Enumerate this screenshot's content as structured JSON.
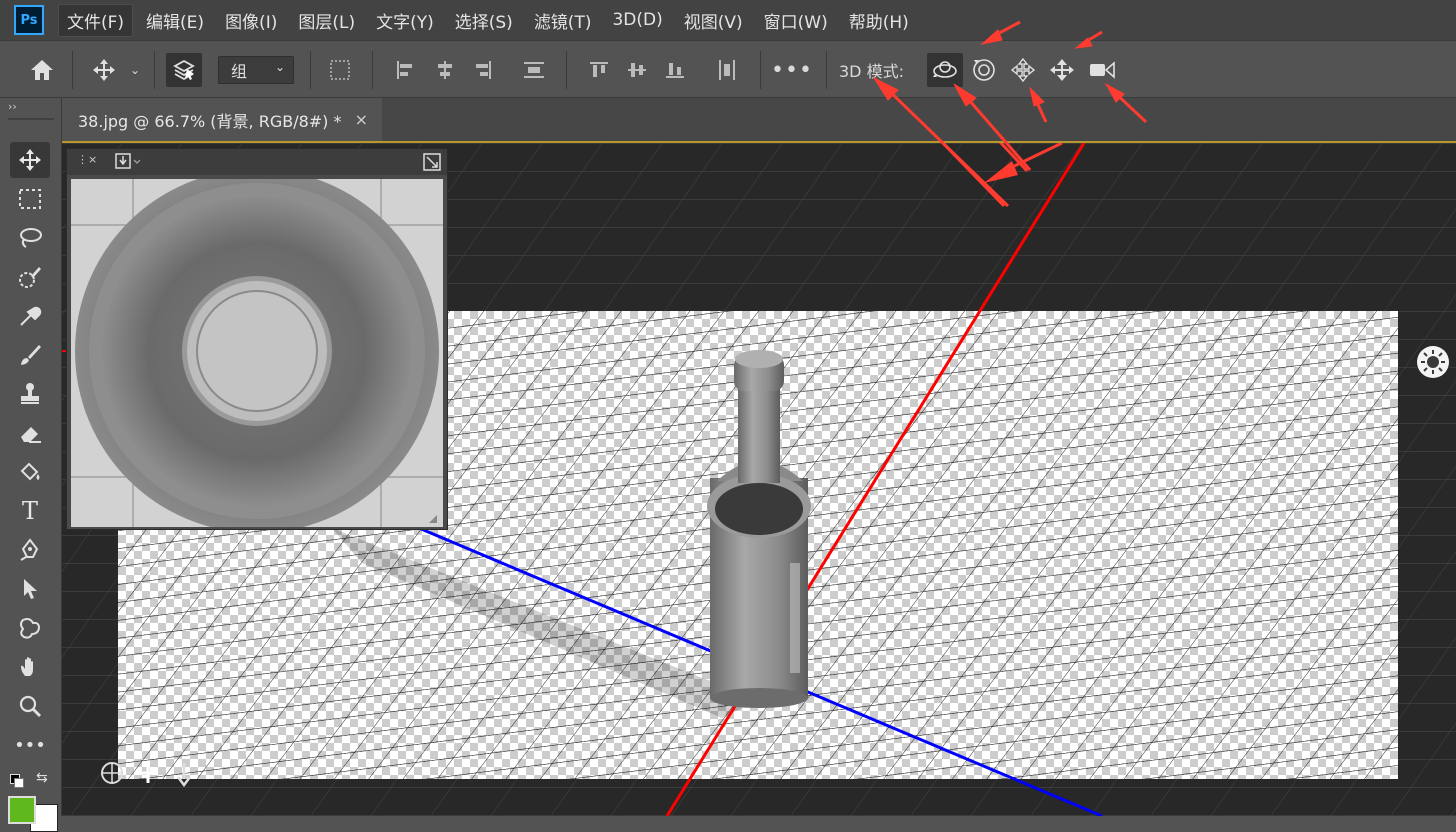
{
  "app": {
    "logo": "Ps"
  },
  "menu": [
    "文件(F)",
    "编辑(E)",
    "图像(I)",
    "图层(L)",
    "文字(Y)",
    "选择(S)",
    "滤镜(T)",
    "3D(D)",
    "视图(V)",
    "窗口(W)",
    "帮助(H)"
  ],
  "options": {
    "select_value": "组",
    "mode_label": "3D 模式:",
    "icons": [
      "home-icon",
      "move-icon",
      "auto-select-layers-icon",
      "transform-controls-icon",
      "align-left-icon",
      "align-hcenter-icon",
      "align-right-icon",
      "distribute-icon",
      "align-top-icon",
      "align-vcenter-icon",
      "align-bottom-icon",
      "distribute-v-icon",
      "more-icon",
      "orbit-3d-icon",
      "roll-3d-icon",
      "pan-3d-icon",
      "slide-3d-icon",
      "zoom-3d-camera-icon"
    ]
  },
  "document": {
    "tab_title": "38.jpg @ 66.7% (背景, RGB/8#) *",
    "close_glyph": "×"
  },
  "tools": [
    "move-tool",
    "marquee-tool",
    "lasso-tool",
    "quick-selection-tool",
    "eyedropper-tool",
    "brush-tool",
    "stamp-tool",
    "eraser-tool",
    "paint-bucket-tool",
    "type-tool",
    "pen-tool",
    "path-selection-tool",
    "custom-shape-tool",
    "hand-tool",
    "zoom-tool",
    "more-tools"
  ],
  "colors": {
    "foreground": "#5fb91c",
    "background": "#ffffff",
    "accent_border": "#b8982a",
    "annotation": "#ff3b30",
    "axis_x": "#ff0000",
    "axis_z": "#0000ff"
  }
}
